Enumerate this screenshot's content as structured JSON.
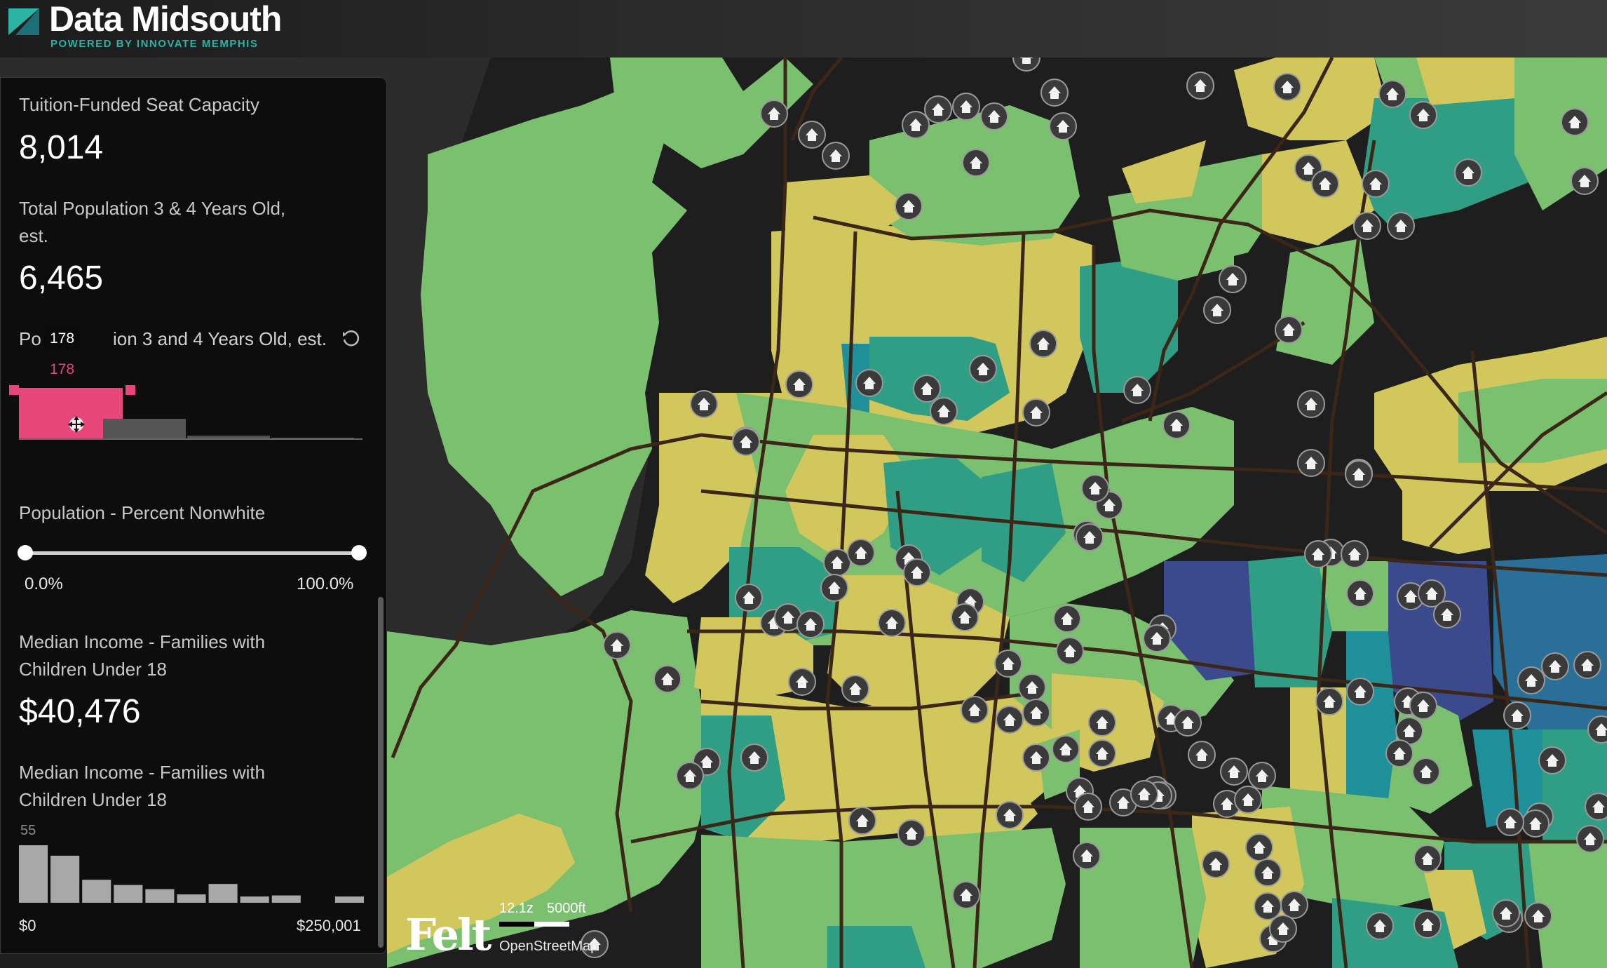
{
  "header": {
    "title": "Data Midsouth",
    "subtitle": "POWERED BY INNOVATE MEMPHIS"
  },
  "panel": {
    "seat_capacity": {
      "label": "Tuition-Funded Seat Capacity",
      "value": "8,014"
    },
    "total_pop": {
      "label_line1": "Total Population 3 & 4 Years Old,",
      "label_line2": "est.",
      "value": "6,465"
    },
    "pop_hist": {
      "label_start": "Po",
      "label_end": "ion 3 and 4 Years Old, est.",
      "tooltip": "178",
      "selected_value": "178",
      "bins": [
        178,
        72,
        14,
        6
      ],
      "selected_bin": 0,
      "selected_color": "#e8457b"
    },
    "nonwhite": {
      "label": "Population - Percent Nonwhite",
      "min_label": "0.0%",
      "max_label": "100.0%",
      "range": [
        0.0,
        1.0
      ]
    },
    "income": {
      "label_line1": "Median Income - Families with",
      "label_line2": "Children Under 18",
      "value": "$40,476"
    },
    "income_hist": {
      "label_line1": "Median Income - Families with",
      "label_line2": "Children Under 18",
      "max_label": "55",
      "min_x": "$0",
      "max_x": "$250,001",
      "bins": [
        55,
        45,
        22,
        17,
        13,
        8,
        18,
        6,
        7,
        0,
        6
      ]
    }
  },
  "map": {
    "zoom": "12.1z",
    "scale": "5000ft",
    "attribution": "OpenStreetMap",
    "brand": "Felt",
    "legend_colors": [
      "#7ac06e",
      "#d2c75c",
      "#2f9e84",
      "#1f8f9a",
      "#3a4a8c",
      "#1c1c1c"
    ],
    "icon": "house-icon"
  }
}
